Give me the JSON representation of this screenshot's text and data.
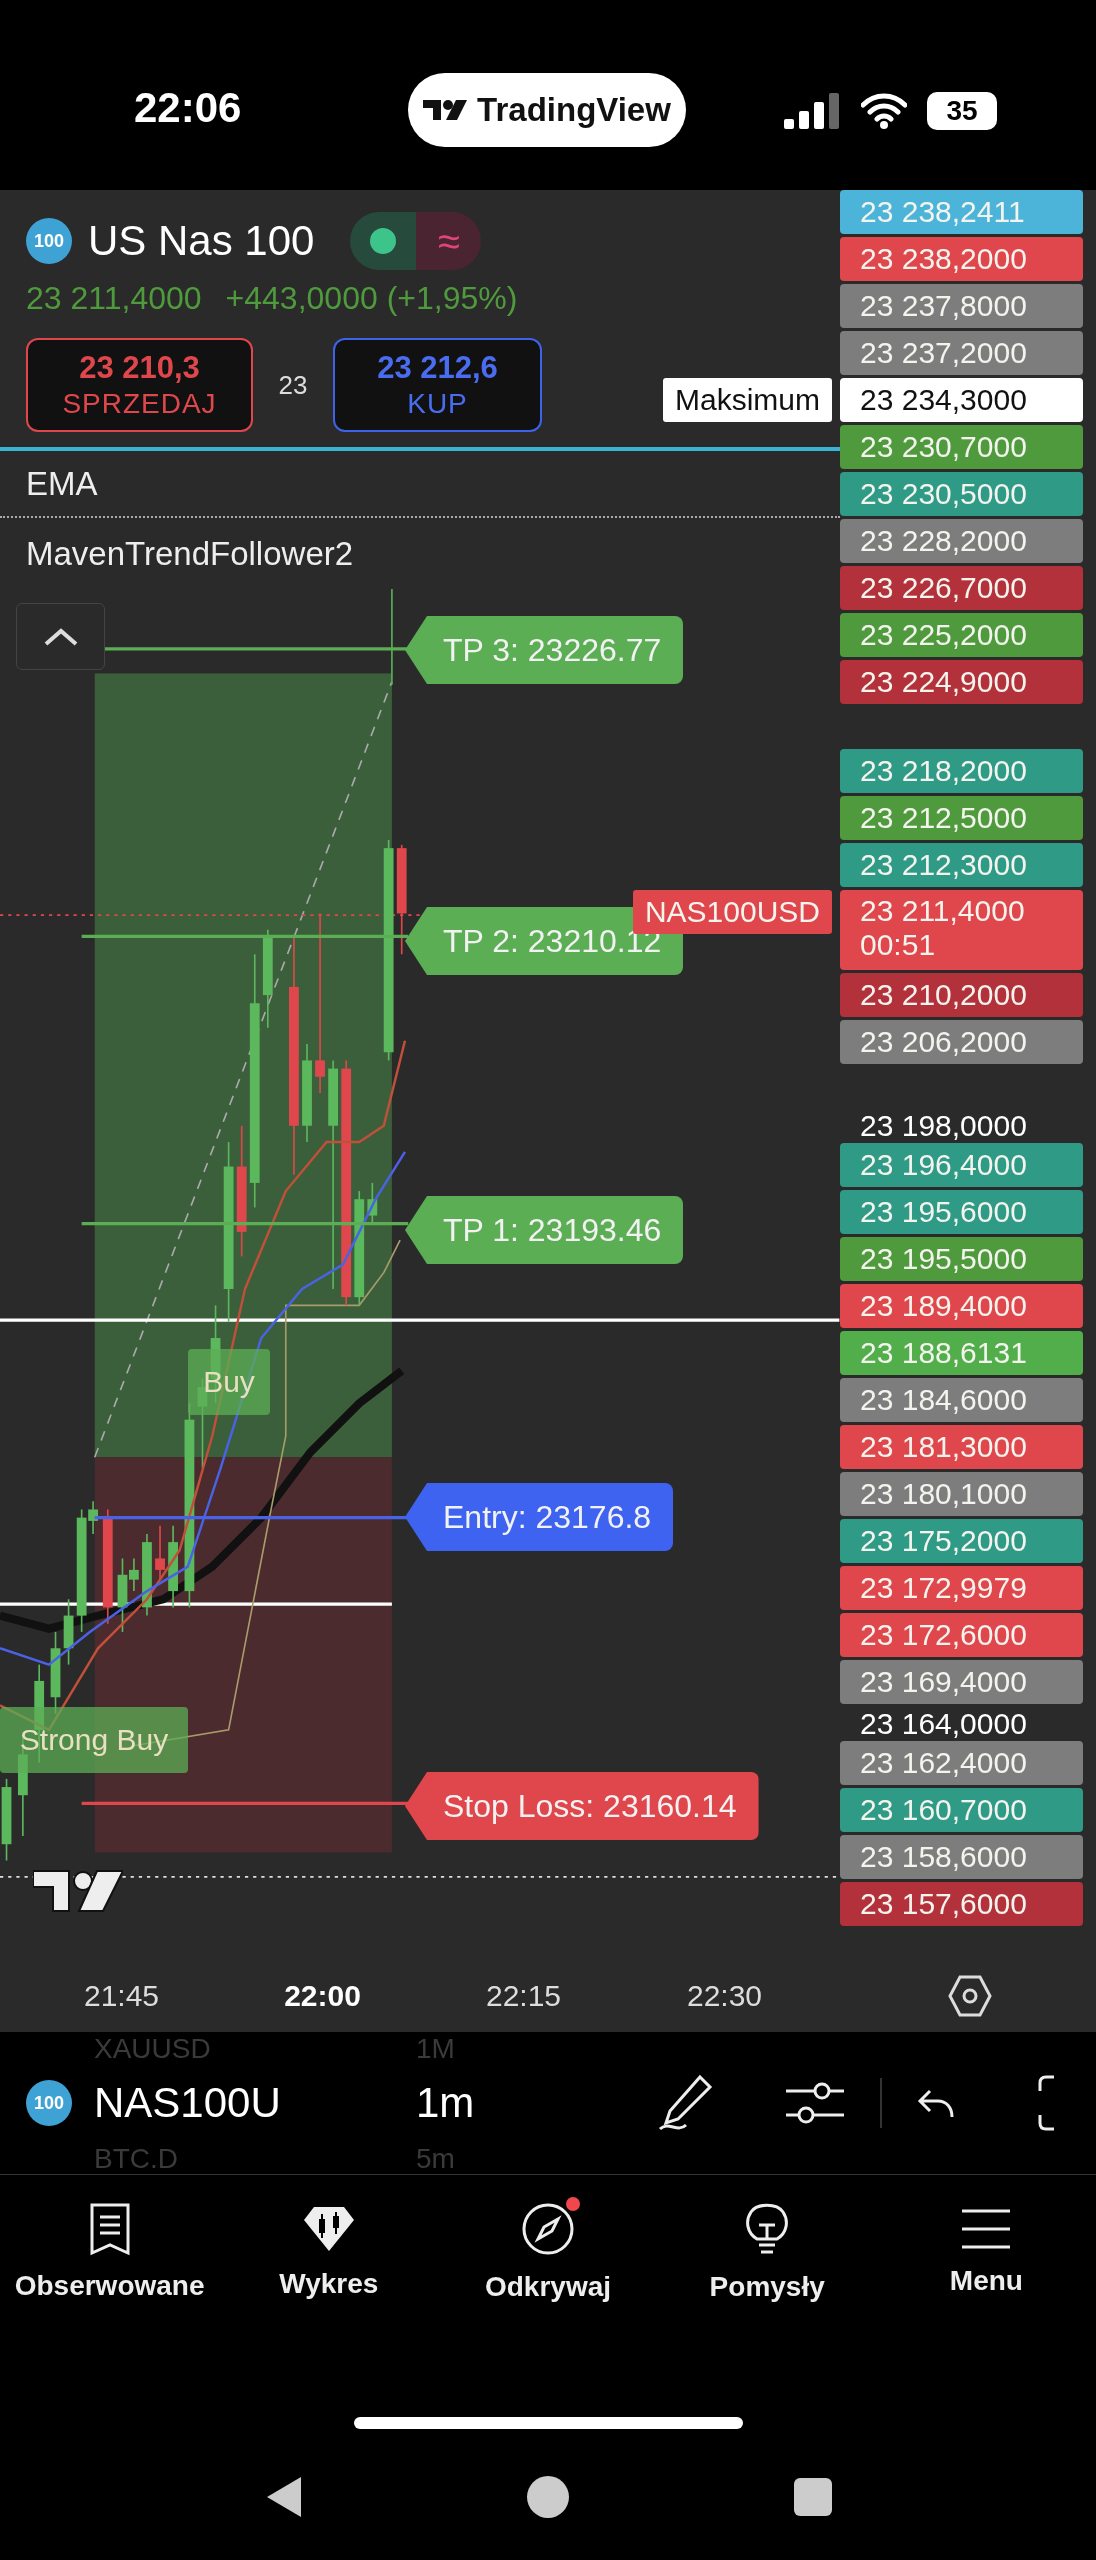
{
  "status_bar": {
    "time": "22:06",
    "app": "TradingView",
    "battery": "35"
  },
  "symbol": {
    "badge": "100",
    "name": "US Nas 100",
    "indicator": "≈",
    "price": "23 211,4000",
    "change": "+443,0000 (+1,95%)"
  },
  "trade": {
    "sell": {
      "price": "23 210,3",
      "label": "SPRZEDAJ"
    },
    "spread": "23",
    "buy": {
      "price": "23 212,6",
      "label": "KUP"
    }
  },
  "indicators": [
    {
      "name": "EMA"
    },
    {
      "name": "MavenTrendFollower2"
    }
  ],
  "chart_labels": [
    {
      "kind": "target",
      "text": "TP 3: 23226.77"
    },
    {
      "kind": "target",
      "text": "TP 2: 23210.12"
    },
    {
      "kind": "target",
      "text": "TP 1: 23193.46"
    },
    {
      "kind": "entry",
      "text": "Entry: 23176.8"
    },
    {
      "kind": "stop",
      "text": "Stop Loss: 23160.14"
    }
  ],
  "signals": [
    {
      "text": "Buy"
    },
    {
      "text": "Strong Buy"
    }
  ],
  "price_scale": {
    "groups": [
      [
        {
          "kind": "tag",
          "value": "23 238,2411",
          "color": "#4bb4d8"
        },
        {
          "kind": "tag",
          "value": "23 238,2000",
          "color": "#e0474c"
        },
        {
          "kind": "tag",
          "value": "23 237,8000",
          "color": "#7d7d7d"
        },
        {
          "kind": "tag",
          "value": "23 237,2000",
          "color": "#7d7d7d"
        },
        {
          "kind": "tag",
          "value": "23 234,3000",
          "color": "#ffffff",
          "note": "Maksimum"
        },
        {
          "kind": "tag",
          "value": "23 230,7000",
          "color": "#4f9a3d"
        },
        {
          "kind": "tag",
          "value": "23 230,5000",
          "color": "#2f9a85"
        },
        {
          "kind": "tag",
          "value": "23 228,2000",
          "color": "#7d7d7d"
        },
        {
          "kind": "tag",
          "value": "23 226,7000",
          "color": "#b3313a"
        },
        {
          "kind": "tag",
          "value": "23 225,2000",
          "color": "#4f9a3d"
        },
        {
          "kind": "tag",
          "value": "23 224,9000",
          "color": "#b3313a"
        }
      ],
      [
        {
          "kind": "tag",
          "value": "23 218,2000",
          "color": "#2f9a85"
        },
        {
          "kind": "tag",
          "value": "23 212,5000",
          "color": "#4f9a3d"
        },
        {
          "kind": "tag",
          "value": "23 212,3000",
          "color": "#2f9a85"
        },
        {
          "kind": "tag",
          "value": "23 211,4000",
          "color": "#e0474c",
          "note": "NAS100USD",
          "countdown": "00:51"
        },
        {
          "kind": "tag",
          "value": "23 210,2000",
          "color": "#b3313a"
        },
        {
          "kind": "tag",
          "value": "23 206,2000",
          "color": "#7d7d7d"
        }
      ],
      [
        {
          "kind": "plain",
          "value": "23 198,0000"
        },
        {
          "kind": "tag",
          "value": "23 196,4000",
          "color": "#2f9a85"
        },
        {
          "kind": "tag",
          "value": "23 195,6000",
          "color": "#2f9a85"
        },
        {
          "kind": "tag",
          "value": "23 195,5000",
          "color": "#4f9a3d"
        },
        {
          "kind": "tag",
          "value": "23 189,4000",
          "color": "#e0474c"
        },
        {
          "kind": "tag",
          "value": "23 188,6131",
          "color": "#52ad4b"
        },
        {
          "kind": "tag",
          "value": "23 184,6000",
          "color": "#7d7d7d"
        },
        {
          "kind": "tag",
          "value": "23 181,3000",
          "color": "#e0474c"
        },
        {
          "kind": "tag",
          "value": "23 180,1000",
          "color": "#7d7d7d"
        },
        {
          "kind": "tag",
          "value": "23 175,2000",
          "color": "#2f9a85"
        },
        {
          "kind": "tag",
          "value": "23 172,9979",
          "color": "#e0474c"
        },
        {
          "kind": "tag",
          "value": "23 172,6000",
          "color": "#e0474c"
        },
        {
          "kind": "tag",
          "value": "23 169,4000",
          "color": "#7d7d7d"
        },
        {
          "kind": "plain",
          "value": "23 164,0000"
        },
        {
          "kind": "tag",
          "value": "23 162,4000",
          "color": "#7d7d7d"
        },
        {
          "kind": "tag",
          "value": "23 160,7000",
          "color": "#2f9a85"
        },
        {
          "kind": "tag",
          "value": "23 158,6000",
          "color": "#7d7d7d"
        },
        {
          "kind": "tag",
          "value": "23 157,6000",
          "color": "#b3313a"
        }
      ]
    ]
  },
  "time_axis": [
    {
      "label": "21:45",
      "major": false
    },
    {
      "label": "22:00",
      "major": true
    },
    {
      "label": "22:15",
      "major": false
    },
    {
      "label": "22:30",
      "major": false
    }
  ],
  "toolbar": {
    "symbols": [
      {
        "symbol": "XAUUSD",
        "interval": "1M",
        "current": false
      },
      {
        "badge": "100",
        "symbol": "NAS100U",
        "interval": "1m",
        "current": true
      },
      {
        "symbol": "BTC.D",
        "interval": "5m",
        "current": false
      }
    ]
  },
  "tabs": [
    {
      "label": "Obserwowane",
      "notification": false
    },
    {
      "label": "Wykres",
      "notification": false
    },
    {
      "label": "Odkrywaj",
      "notification": true
    },
    {
      "label": "Pomysły",
      "notification": false
    },
    {
      "label": "Menu",
      "notification": false
    }
  ]
}
